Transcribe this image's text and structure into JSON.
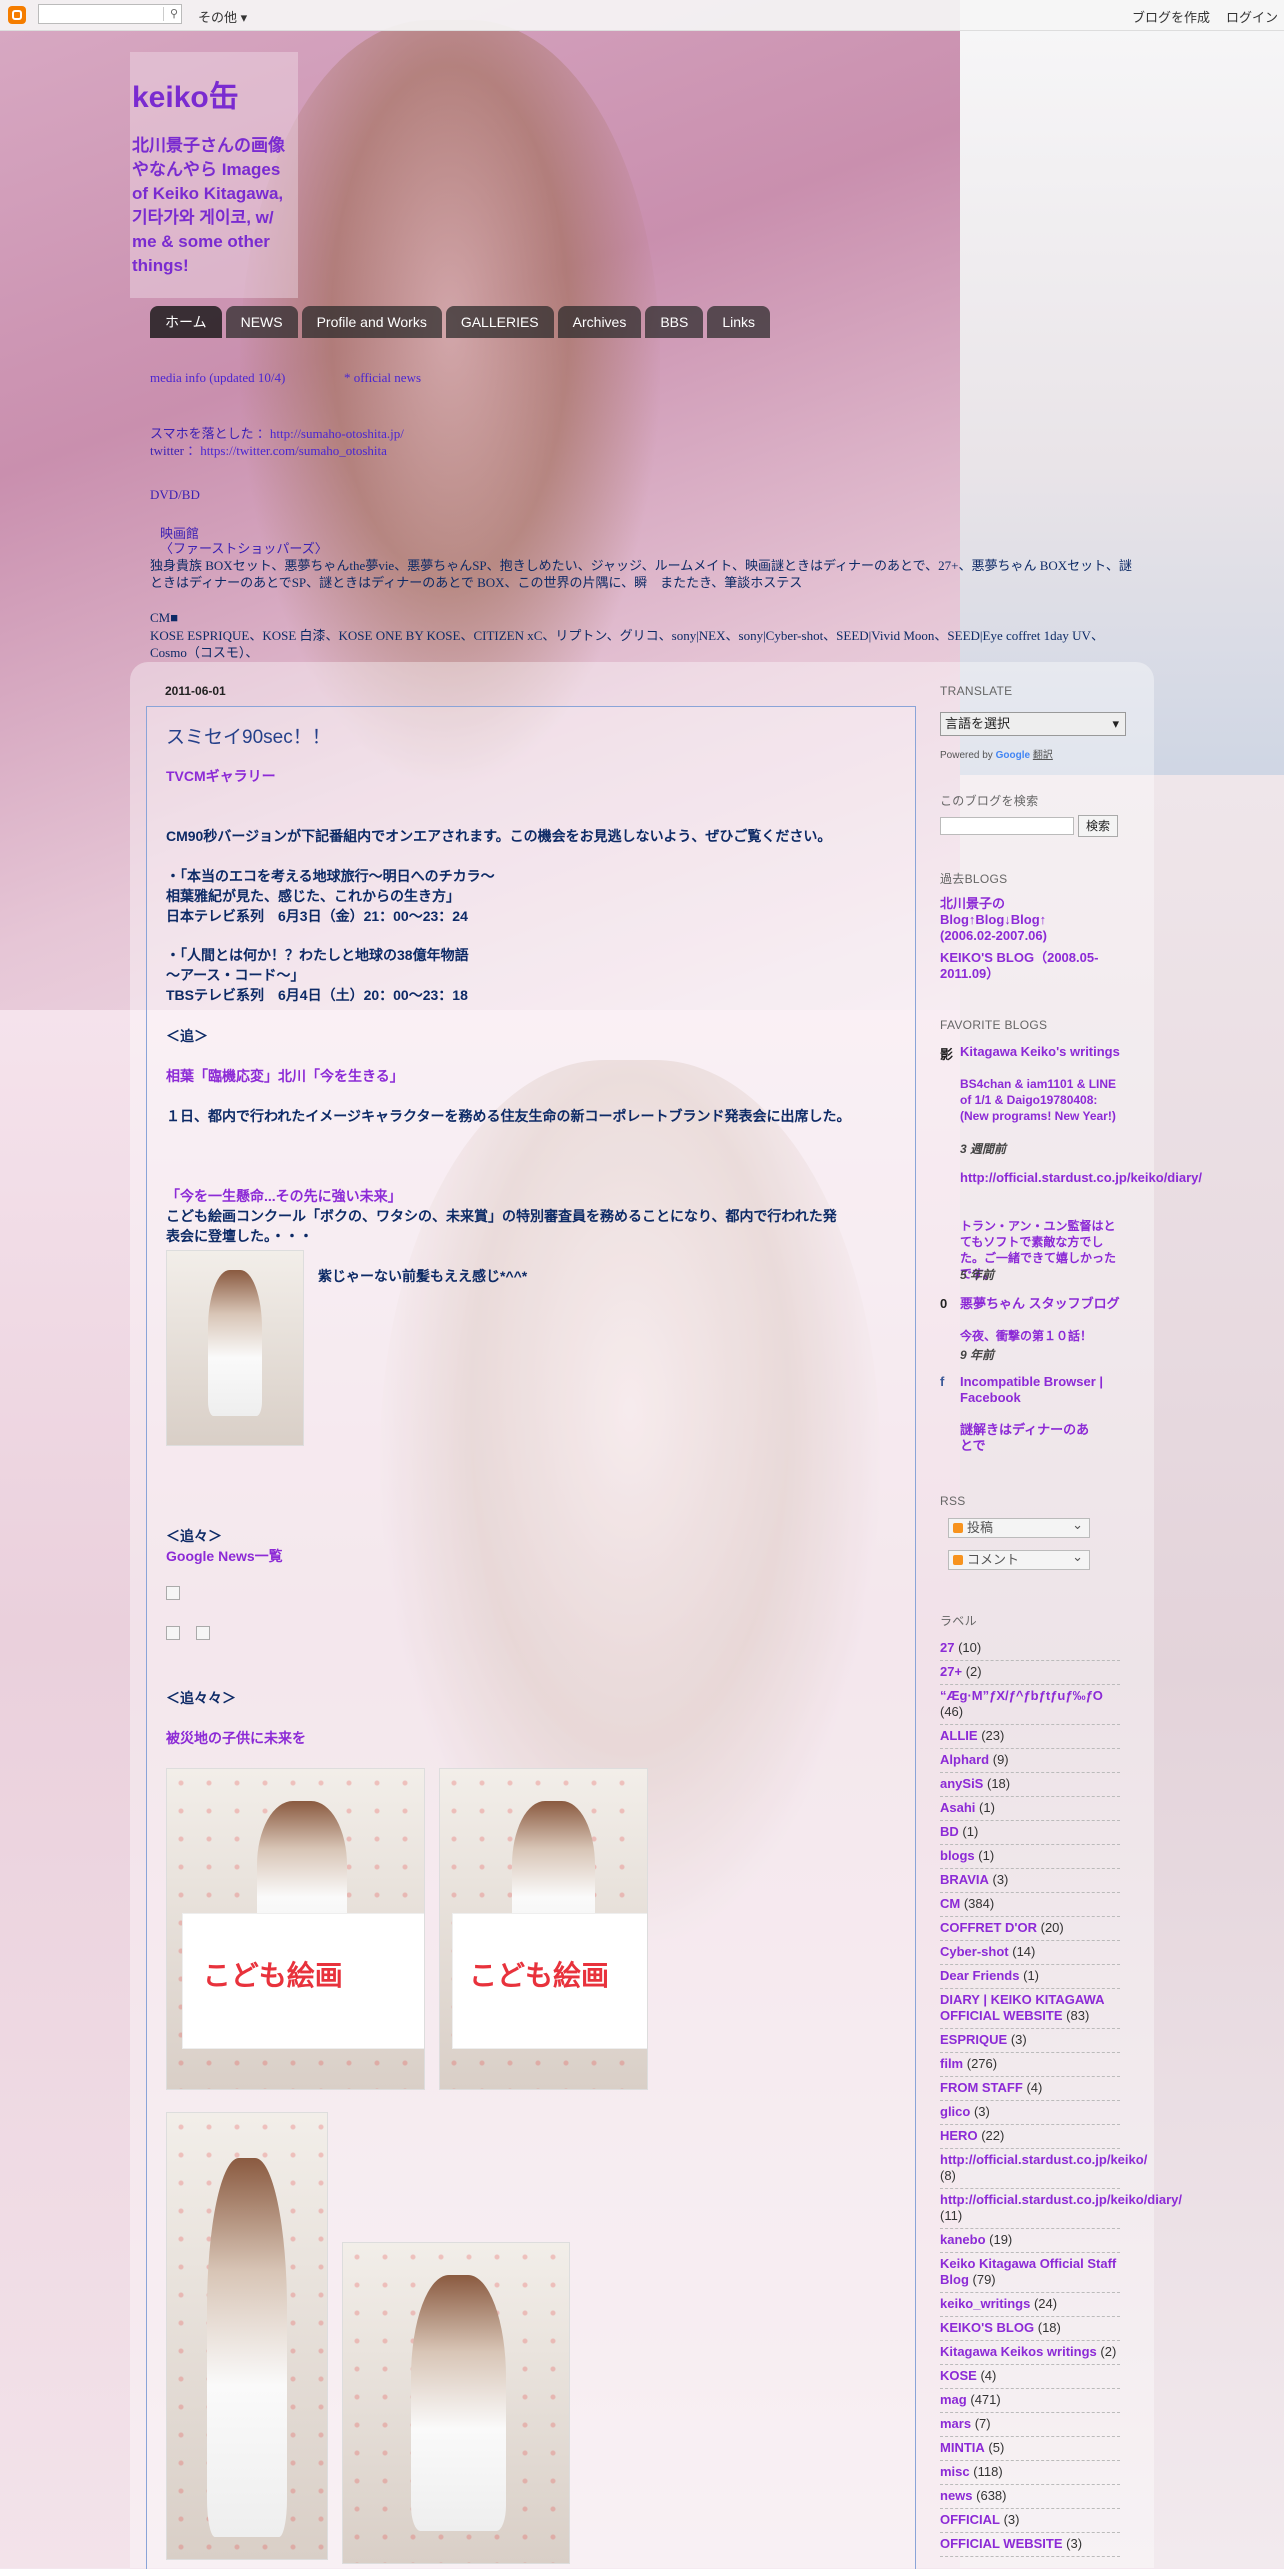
{
  "navbar": {
    "more": "その他",
    "create_blog": "ブログを作成",
    "login": "ログイン"
  },
  "header": {
    "title": "keiko缶",
    "description": "北川景子さんの画像やなんやら Images of Keiko Kitagawa, 기타가와 게이코, w/ me & some other things!"
  },
  "tabs": [
    "ホーム",
    "NEWS",
    "Profile and Works",
    "GALLERIES",
    "Archives",
    "BBS",
    "Links"
  ],
  "cross": {
    "line1a": "media info (updated 10/4)",
    "line1b": "* official news",
    "line2a": "スマホを落とした",
    "line2b": "：http://sumaho-otoshita.jp/",
    "line3a": "twitter",
    "line3b": "：https://twitter.com/sumaho_otoshita",
    "line4": "DVD/BD",
    "line5a": "映画館",
    "line5b": "〈ファーストショッパーズ〉",
    "line6": "独身貴族 BOXセット、悪夢ちゃんthe夢vie、悪夢ちゃんSP、抱きしめたい、ジャッジ、ルームメイト、映画謎ときはディナーのあとで、27+、悪夢ちゃん BOXセット、謎ときはディナーのあとでSP、謎ときはディナーのあとで BOX、この世界の片隅に、瞬　またたき、筆談ホステス",
    "line7": "CM■",
    "line8": "KOSE ESPRIQUE、KOSE 白漆、KOSE ONE BY KOSE、CITIZEN xC、リプトン、グリコ、sony|NEX、sony|Cyber-shot、SEED|Vivid Moon、SEED|Eye coffret 1day UV、Cosmo（コスモ）、"
  },
  "post": {
    "date": "2011-06-01",
    "title": "スミセイ90sec！！",
    "tvcm_link": "TVCMギャラリー",
    "p1": "CM90秒バージョンが下記番組内でオンエアされます。この機会をお見逃しないよう、ぜひご覧ください。",
    "p2a": "・「本当のエコを考える地球旅行～明日へのチカラ～",
    "p2b": "相葉雅紀が見た、感じた、これからの生き方」",
    "p2c": "日本テレビ系列　6月3日（金）21：00～23：24",
    "p3a": "・「人間とは何か！？わたしと地球の38億年物語",
    "p3b": "～アース・コード～」",
    "p3c": "TBSテレビ系列　6月4日（土）20：00～23：18",
    "oi1": "＜追＞",
    "link2": "相葉「臨機応変」北川「今を生きる」",
    "p4a": "１日、都内で行われたイメージキャラクターを務める住友生命の新コーポレートブランド発表会に出席した。",
    "p4b": "た。",
    "link3": "「今を一生懸命...その先に強い未来」",
    "p5a": "こども絵画コンクール「ボクの、ワタシの、未来賞」の特別審査員を務めることになり、都内で行われた発",
    "p5b": "表会に登壇した。・・・",
    "caption": "紫じゃーない前髪もええ感じ*^^*",
    "oi2": "＜追々＞",
    "link4": "Google News一覧",
    "oi3": "＜追々々＞",
    "link5": "被災地の子供に未来を",
    "board_text": "こども絵画"
  },
  "sidebar": {
    "translate_h": "TRANSLATE",
    "translate_select": "言語を選択",
    "powered": "Powered by",
    "google": "Google",
    "translate_word": "翻訳",
    "search_h": "このブログを検索",
    "search_btn": "検索",
    "past_h": "過去BLOGS",
    "past1": "北川景子の Blog↑Blog↓Blog↑ (2006.02-2007.06)",
    "past2": "KEIKO'S BLOG（2008.05-2011.09）",
    "fav_h": "FAVORITE BLOGS",
    "favs": [
      {
        "icon": "影",
        "title": "Kitagawa Keiko's writings",
        "sub": "BS4chan & iam1101 & LINE of 1/1 & Daigo19780408: (New programs! New Year!)",
        "ago": "3 週間前"
      },
      {
        "icon": "",
        "title": "http://official.stardust.co.jp/keiko/diary/",
        "sub": "トラン・アン・ユン監督はとてもソフトで素敵な方でした。ご一緒できて嬉しかったです。",
        "ago": "5 年前"
      },
      {
        "icon": "0",
        "title": "悪夢ちゃん スタッフブログ",
        "sub": "今夜、衝撃の第１０話！",
        "ago": "9 年前"
      },
      {
        "icon": "f",
        "title": "Incompatible Browser | Facebook",
        "sub": "",
        "ago": ""
      },
      {
        "icon": "",
        "title": "謎解きはディナーのあとで",
        "sub": "",
        "ago": ""
      }
    ],
    "rss_h": "RSS",
    "rss1": "投稿",
    "rss2": "コメント",
    "labels_h": "ラベル",
    "labels": [
      [
        "27",
        "(10)"
      ],
      [
        "27+",
        "(2)"
      ],
      [
        "“Æg·M”ƒX/ƒ^ƒbƒtƒuƒ‰ƒO",
        "(46)"
      ],
      [
        "ALLIE",
        "(23)"
      ],
      [
        "Alphard",
        "(9)"
      ],
      [
        "anySiS",
        "(18)"
      ],
      [
        "Asahi",
        "(1)"
      ],
      [
        "BD",
        "(1)"
      ],
      [
        "blogs",
        "(1)"
      ],
      [
        "BRAVIA",
        "(3)"
      ],
      [
        "CM",
        "(384)"
      ],
      [
        "COFFRET D'OR",
        "(20)"
      ],
      [
        "Cyber-shot",
        "(14)"
      ],
      [
        "Dear Friends",
        "(1)"
      ],
      [
        "DIARY | KEIKO KITAGAWA OFFICIAL WEBSITE",
        "(83)"
      ],
      [
        "ESPRIQUE",
        "(3)"
      ],
      [
        "film",
        "(276)"
      ],
      [
        "FROM STAFF",
        "(4)"
      ],
      [
        "glico",
        "(3)"
      ],
      [
        "HERO",
        "(22)"
      ],
      [
        "http://official.stardust.co.jp/keiko/",
        "(8)"
      ],
      [
        "http://official.stardust.co.jp/keiko/diary/",
        "(11)"
      ],
      [
        "kanebo",
        "(19)"
      ],
      [
        "Keiko Kitagawa Official Staff Blog",
        "(79)"
      ],
      [
        "keiko_writings",
        "(24)"
      ],
      [
        "KEIKO'S BLOG",
        "(18)"
      ],
      [
        "Kitagawa Keikos writings",
        "(2)"
      ],
      [
        "KOSE",
        "(4)"
      ],
      [
        "mag",
        "(471)"
      ],
      [
        "mars",
        "(7)"
      ],
      [
        "MINTIA",
        "(5)"
      ],
      [
        "misc",
        "(118)"
      ],
      [
        "news",
        "(638)"
      ],
      [
        "OFFICIAL",
        "(3)"
      ],
      [
        "OFFICIAL WEBSITE",
        "(3)"
      ]
    ]
  }
}
